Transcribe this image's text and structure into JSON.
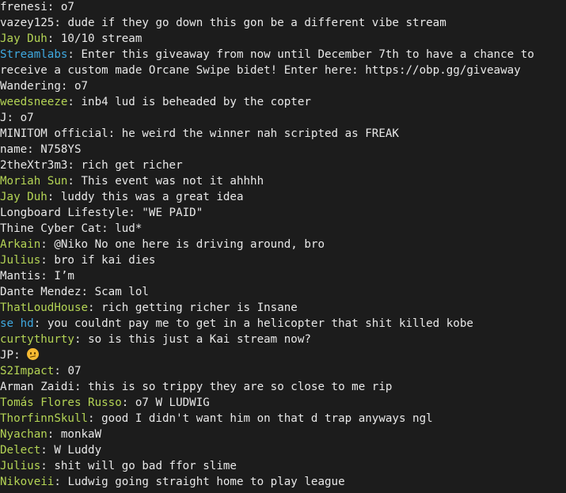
{
  "colors": {
    "background": "#1c1c1c",
    "default_text": "#e8e8e8",
    "username_green": "#b4d455",
    "username_blue": "#3fa9e0"
  },
  "messages": [
    {
      "user": "frenesi",
      "color": "#e8e8e8",
      "text": "o7"
    },
    {
      "user": "vazey125",
      "color": "#e8e8e8",
      "text": "dude if they go down this gon be a different vibe stream"
    },
    {
      "user": "Jay Duh",
      "color": "#b4d455",
      "text": "10/10 stream"
    },
    {
      "user": "Streamlabs",
      "color": "#3fa9e0",
      "text": "Enter this giveaway from now until December 7th to have a chance to receive a custom made Orcane Swipe bidet! Enter here: https://obp.gg/giveaway"
    },
    {
      "user": "Wandering",
      "color": "#e8e8e8",
      "text": "o7"
    },
    {
      "user": "weedsneeze",
      "color": "#b4d455",
      "text": "inb4 lud is beheaded by the copter"
    },
    {
      "user": "J",
      "color": "#e8e8e8",
      "text": "o7"
    },
    {
      "user": "MINITOM official",
      "color": "#e8e8e8",
      "text": "he weird the winner nah scripted as FREAK"
    },
    {
      "user": "name",
      "color": "#e8e8e8",
      "text": "N758YS"
    },
    {
      "user": "2theXtr3m3",
      "color": "#e8e8e8",
      "text": "rich get richer"
    },
    {
      "user": "Moriah Sun",
      "color": "#b4d455",
      "text": "This event was not it ahhhh"
    },
    {
      "user": "Jay Duh",
      "color": "#b4d455",
      "text": "luddy this was a great idea"
    },
    {
      "user": "Longboard Lifestyle",
      "color": "#e8e8e8",
      "text": "\"WE PAID\""
    },
    {
      "user": "Thine Cyber Cat",
      "color": "#e8e8e8",
      "text": "lud*"
    },
    {
      "user": "Arkain",
      "color": "#b4d455",
      "text": "@Niko No one here is driving around, bro"
    },
    {
      "user": "Julius",
      "color": "#b4d455",
      "text": "bro if kai dies"
    },
    {
      "user": "Mantis",
      "color": "#e8e8e8",
      "text": "I’m"
    },
    {
      "user": "Dante Mendez",
      "color": "#e8e8e8",
      "text": "Scam lol"
    },
    {
      "user": "ThatLoudHouse",
      "color": "#b4d455",
      "text": "rich getting richer is Insane"
    },
    {
      "user": "se hd",
      "color": "#3fa9e0",
      "text": "you couldnt pay me to get in a helicopter that shit killed kobe"
    },
    {
      "user": "curtythurty",
      "color": "#b4d455",
      "text": "so is this just a Kai stream now?"
    },
    {
      "user": "JP",
      "color": "#e8e8e8",
      "text": "",
      "emoji": "confused-face-emoji"
    },
    {
      "user": "S2Impact",
      "color": "#b4d455",
      "text": "07"
    },
    {
      "user": "Arman Zaidi",
      "color": "#e8e8e8",
      "text": "this is so trippy they are so close to me rip"
    },
    {
      "user": "Tomás Flores Russo",
      "color": "#b4d455",
      "text": "o7 W LUDWIG"
    },
    {
      "user": "ThorfinnSkull",
      "color": "#b4d455",
      "text": "good I didn't want him on that d trap anyways ngl"
    },
    {
      "user": "Nyachan",
      "color": "#b4d455",
      "text": "monkaW"
    },
    {
      "user": "Delect",
      "color": "#b4d455",
      "text": "W Luddy"
    },
    {
      "user": "Julius",
      "color": "#b4d455",
      "text": "shit will go bad ffor slime"
    },
    {
      "user": "Nikoveii",
      "color": "#b4d455",
      "text": "Ludwig going straight home to play league"
    }
  ]
}
